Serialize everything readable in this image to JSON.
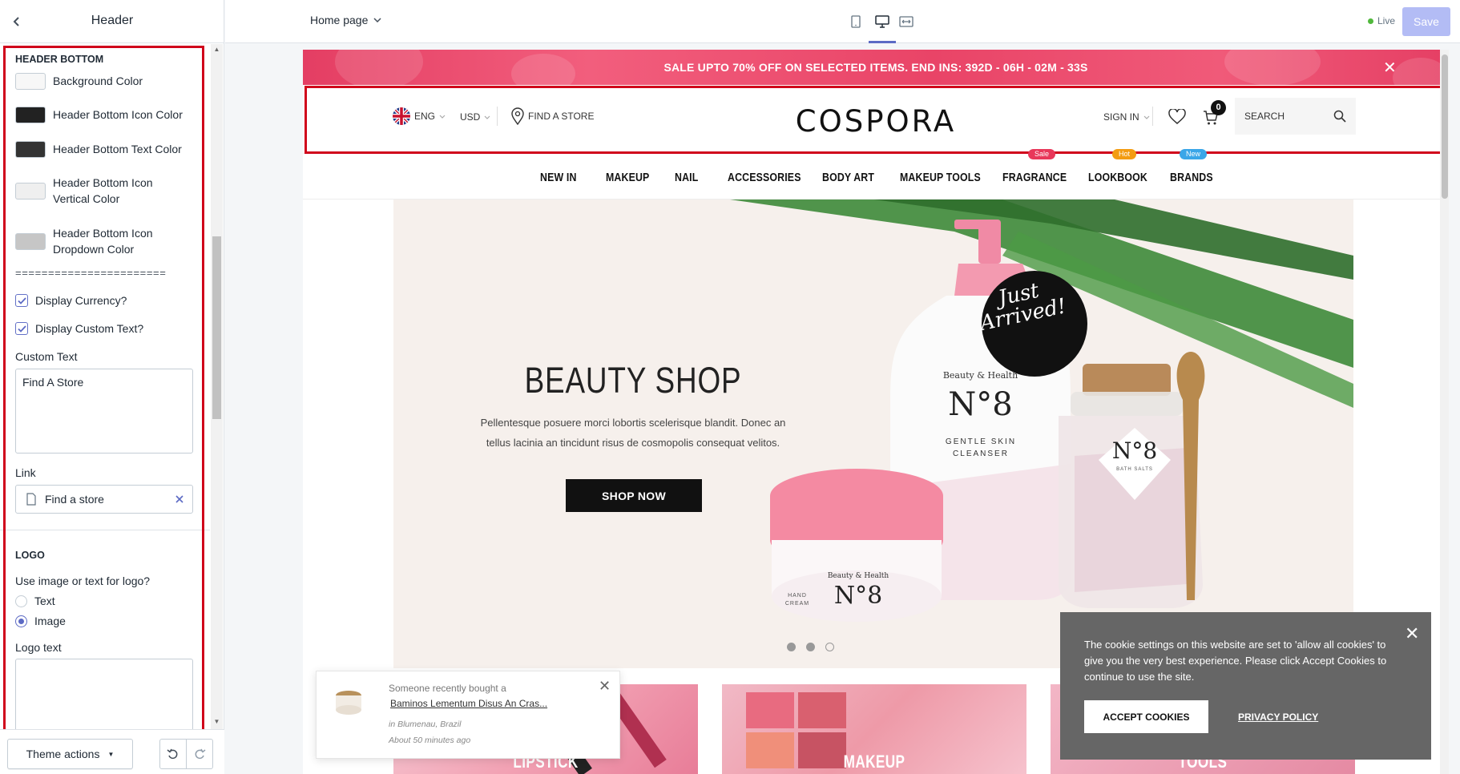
{
  "sidebar": {
    "title": "Header",
    "section_header_bottom": "HEADER BOTTOM",
    "colors": [
      {
        "label": "Background Color",
        "swatch": "#f7f7f7"
      },
      {
        "label": "Header Bottom Icon Color",
        "swatch": "#222222"
      },
      {
        "label": "Header Bottom Text Color",
        "swatch": "#333333"
      },
      {
        "label": "Header Bottom Icon Vertical Color",
        "swatch": "#efefef"
      },
      {
        "label": "Header Bottom Icon Dropdown Color",
        "swatch": "#c6c6c6"
      }
    ],
    "divider": "=======================",
    "display_currency": {
      "label": "Display Currency?",
      "checked": true
    },
    "display_custom_text": {
      "label": "Display Custom Text?",
      "checked": true
    },
    "custom_text_label": "Custom Text",
    "custom_text_value": "Find A Store",
    "link_label": "Link",
    "link_value": "Find a store",
    "section_logo": "LOGO",
    "logo_choice_label": "Use image or text for logo?",
    "logo_options": [
      {
        "label": "Text",
        "selected": false
      },
      {
        "label": "Image",
        "selected": true
      }
    ],
    "logo_text_label": "Logo text",
    "logo_text_value": "",
    "theme_actions": "Theme actions"
  },
  "topbar": {
    "page_select": "Home page",
    "live_label": "Live",
    "save_label": "Save",
    "accent": "#5c6ac4"
  },
  "preview": {
    "announcement": "SALE UPTO 70% OFF ON SELECTED ITEMS. END INS: 392D - 06H - 02M - 33S",
    "language": "ENG",
    "currency": "USD",
    "find_store": "FIND A STORE",
    "logo": "COSPORA",
    "sign_in": "SIGN IN",
    "cart_count": "0",
    "search_placeholder": "SEARCH",
    "nav": [
      {
        "label": "NEW IN"
      },
      {
        "label": "MAKEUP"
      },
      {
        "label": "NAIL"
      },
      {
        "label": "ACCESSORIES"
      },
      {
        "label": "BODY ART"
      },
      {
        "label": "MAKEUP TOOLS"
      },
      {
        "label": "FRAGRANCE",
        "badge": "Sale",
        "badge_color": "#e8385a"
      },
      {
        "label": "LOOKBOOK",
        "badge": "Hot",
        "badge_color": "#f39c12"
      },
      {
        "label": "BRANDS",
        "badge": "New",
        "badge_color": "#3aa6e8"
      }
    ],
    "hero": {
      "title": "BEAUTY SHOP",
      "description": "Pellentesque posuere morci lobortis scelerisque blandit. Donec an tellus lacinia an tincidunt risus de cosmopolis consequat velitos.",
      "cta": "SHOP NOW",
      "sticker": "Just Arrived!",
      "bottle_brand": "Beauty & Health",
      "bottle_number": "N°8",
      "bottle_desc": "GENTLE SKIN CLEANSER",
      "jar_desc": "HAND CREAM",
      "salt_desc": "BATH SALTS",
      "slides_total": 3,
      "slide_active": 1
    },
    "categories": [
      "LIPSTICK",
      "MAKEUP",
      "TOOLS"
    ],
    "recent_purchase": {
      "intro": "Someone recently bought a",
      "product": "Baminos Lementum Disus An Cras...",
      "location": "in Blumenau, Brazil",
      "time": "About 50 minutes ago"
    },
    "cookie": {
      "text": "The cookie settings on this website are set to 'allow all cookies' to give you the very best experience. Please click Accept Cookies to continue to use the site.",
      "accept": "ACCEPT COOKIES",
      "privacy": "PRIVACY POLICY"
    }
  }
}
